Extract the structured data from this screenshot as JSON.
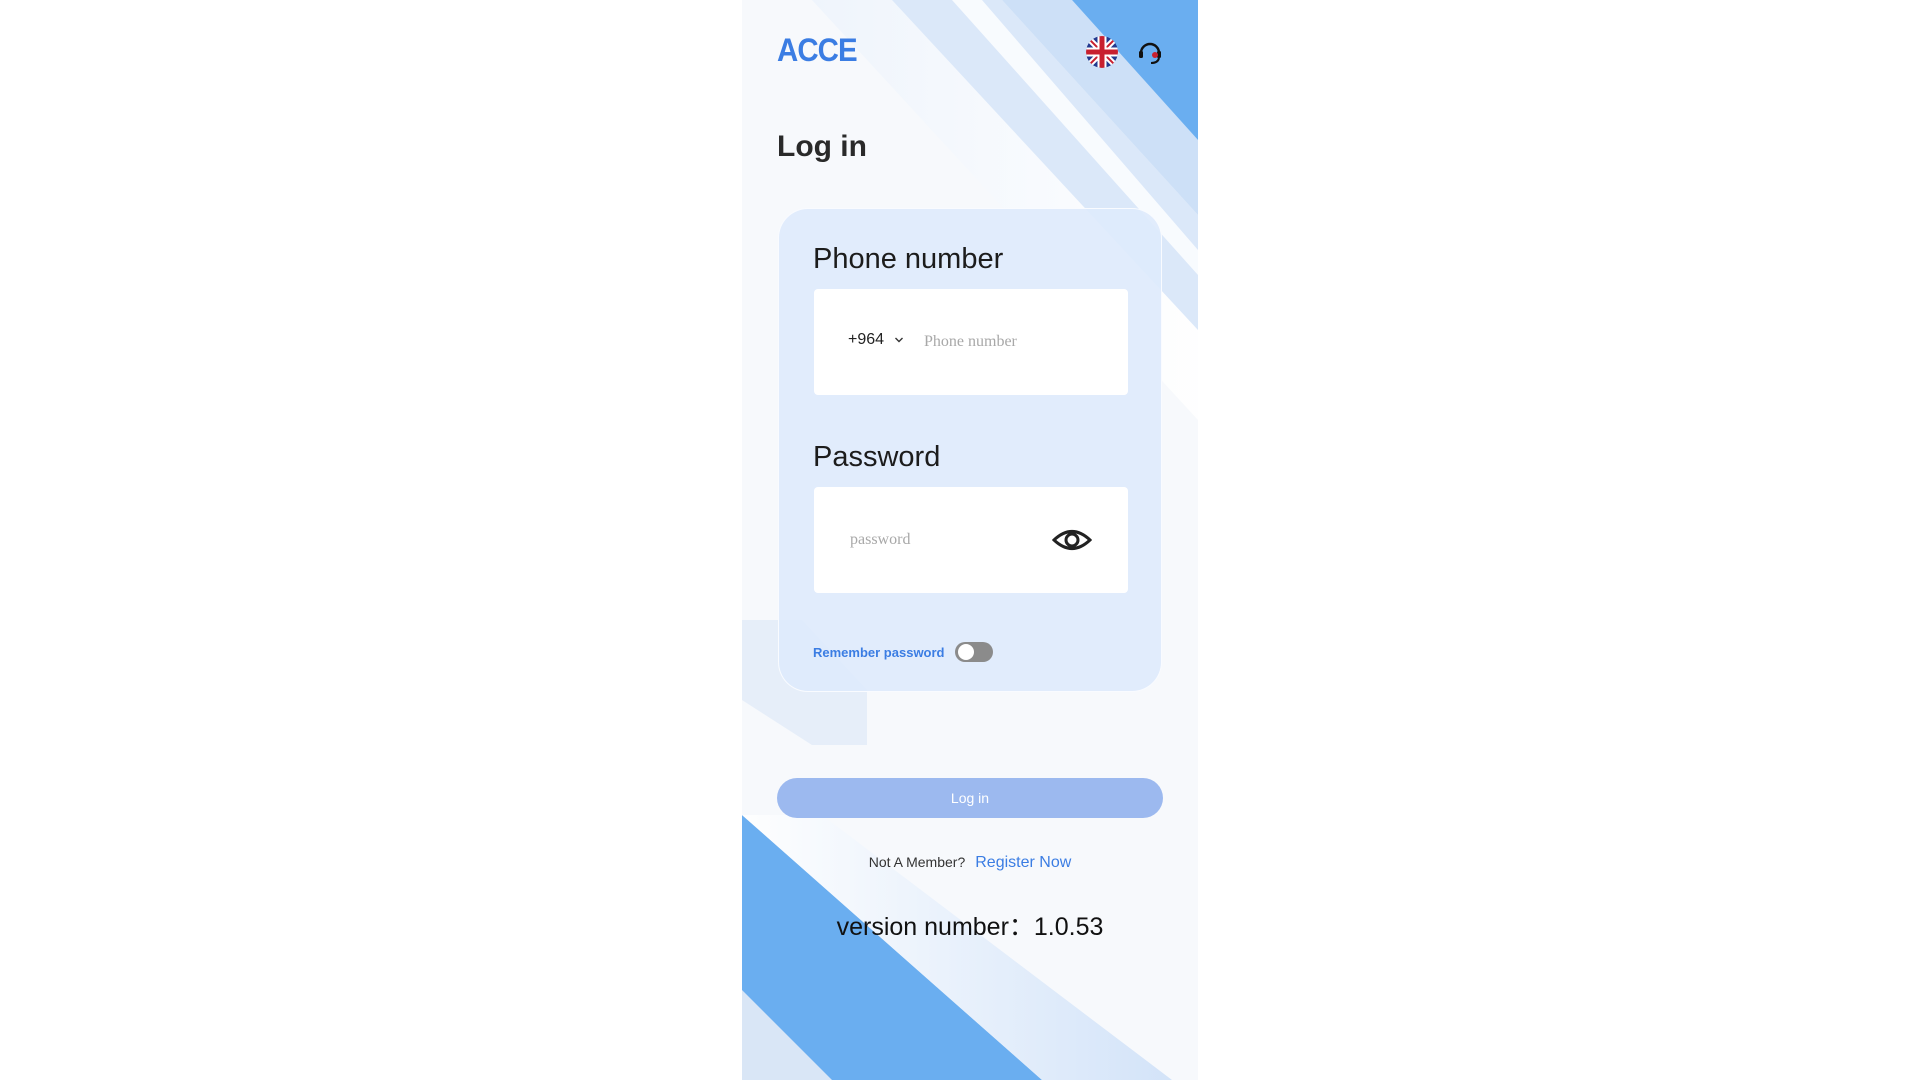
{
  "header": {
    "logo_text": "ACCE",
    "language_icon": "uk-flag-icon",
    "service_icon": "customer-service-icon"
  },
  "page": {
    "title": "Log in"
  },
  "form": {
    "phone_label": "Phone number",
    "country_code": "+964",
    "phone_placeholder": "Phone number",
    "phone_value": "",
    "password_label": "Password",
    "password_placeholder": "password",
    "password_value": "",
    "visibility_icon": "eye-icon",
    "remember_label": "Remember password",
    "remember_on": false,
    "submit_label": "Log in"
  },
  "footer": {
    "not_member_text": "Not A Member?",
    "register_link": "Register Now",
    "version_text": "version number：1.0.53"
  },
  "colors": {
    "accent": "#3b7de3",
    "button_disabled": "#9cb9ef",
    "card_bg": "#deeafc",
    "stripe_blue": "#6aaef0"
  }
}
